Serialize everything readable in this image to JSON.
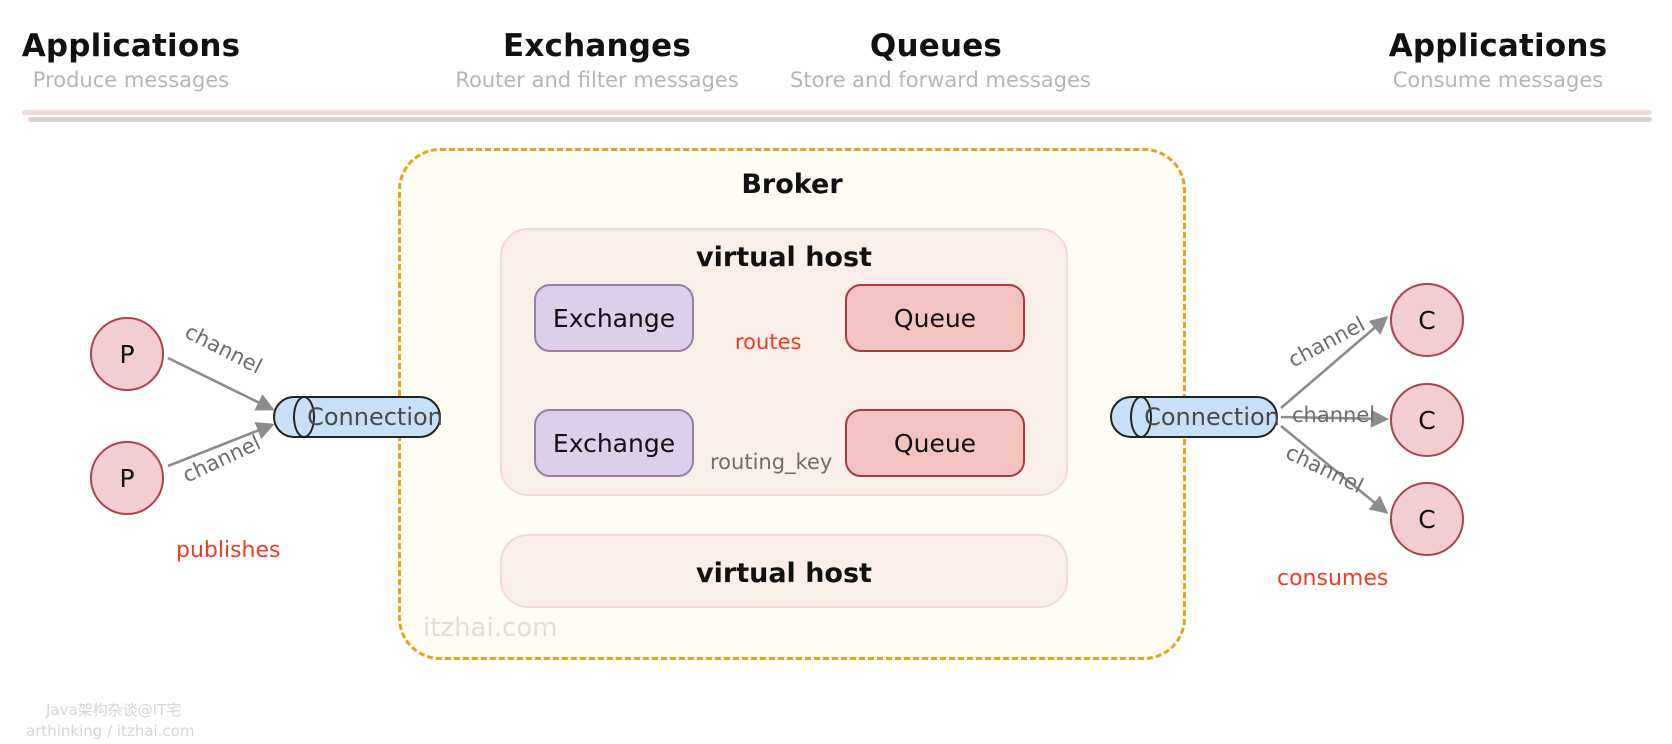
{
  "header": {
    "columns": [
      {
        "title": "Applications",
        "subtitle": "Produce messages"
      },
      {
        "title": "Exchanges",
        "subtitle": "Router and filter messages"
      },
      {
        "title": "Queues",
        "subtitle": "Store and forward messages"
      },
      {
        "title": "Applications",
        "subtitle": "Consume messages"
      }
    ]
  },
  "broker": {
    "title": "Broker",
    "watermark": "itzhai.com",
    "vhost_top_label": "virtual host",
    "vhost_bottom_label": "virtual host",
    "nodes": {
      "exchange_1": "Exchange",
      "exchange_2": "Exchange",
      "queue_1": "Queue",
      "queue_2": "Queue"
    }
  },
  "producers": [
    {
      "label": "P"
    },
    {
      "label": "P"
    }
  ],
  "consumers": [
    {
      "label": "C"
    },
    {
      "label": "C"
    },
    {
      "label": "C"
    }
  ],
  "connections": {
    "left": "Connection",
    "right": "Connection"
  },
  "edges": {
    "channel_p1": "channel",
    "channel_p2": "channel",
    "publishes": "publishes",
    "routes": "routes",
    "routing_key": "routing_key",
    "channel_c1": "channel",
    "channel_c2": "channel",
    "channel_c3": "channel",
    "consumes": "consumes"
  },
  "credit": {
    "line1": "Java架构杂谈@IT宅",
    "line2": "arthinking / itzhai.com"
  },
  "colors": {
    "broker_border": "#e3a31b",
    "broker_fill": "#fffcf5",
    "vhost_fill": "#faefe8",
    "vhost_border": "#f4d9d3",
    "exchange_fill": "#ddcfe8",
    "exchange_border": "#9c7ba8",
    "queue_fill": "#f3c3c1",
    "queue_border": "#a83a3a",
    "endpoint_fill": "#f2ced0",
    "endpoint_border": "#a8454d",
    "connection_fill": "#c6e0f7",
    "accent_red": "#ef3b22",
    "edge_gray": "#8c8c8c"
  }
}
